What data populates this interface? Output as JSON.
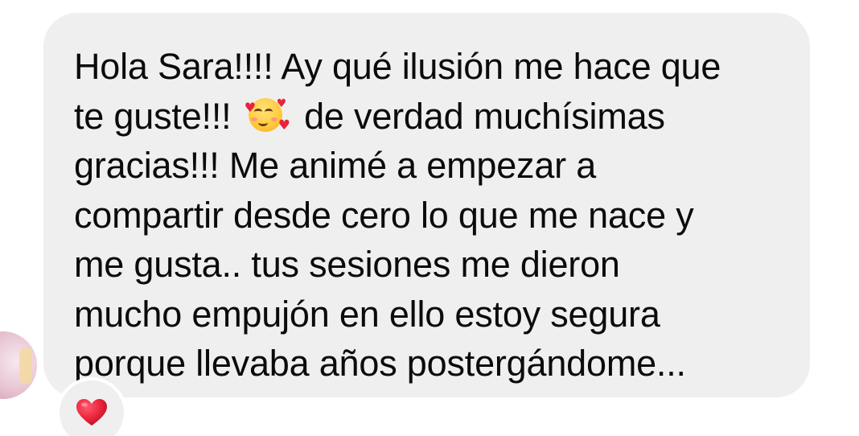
{
  "message": {
    "lines": [
      "Hola Sara!!!! Ay qué ilusión me hace que",
      "te guste!!!",
      "de verdad muchísimas",
      "gracias!!! Me animé a empezar a",
      "compartir desde cero lo que me nace y",
      "me gusta.. tus sesiones me dieron",
      "mucho empujón en ello estoy segura",
      "porque llevaba años postergándome..."
    ],
    "inline_emoji": "smiling-face-with-hearts-icon"
  },
  "reaction": {
    "emoji": "red-heart-icon",
    "color": "#e8243c"
  },
  "colors": {
    "bubble_background": "#efefef",
    "text": "#0b0b0b",
    "page_background": "#ffffff"
  }
}
